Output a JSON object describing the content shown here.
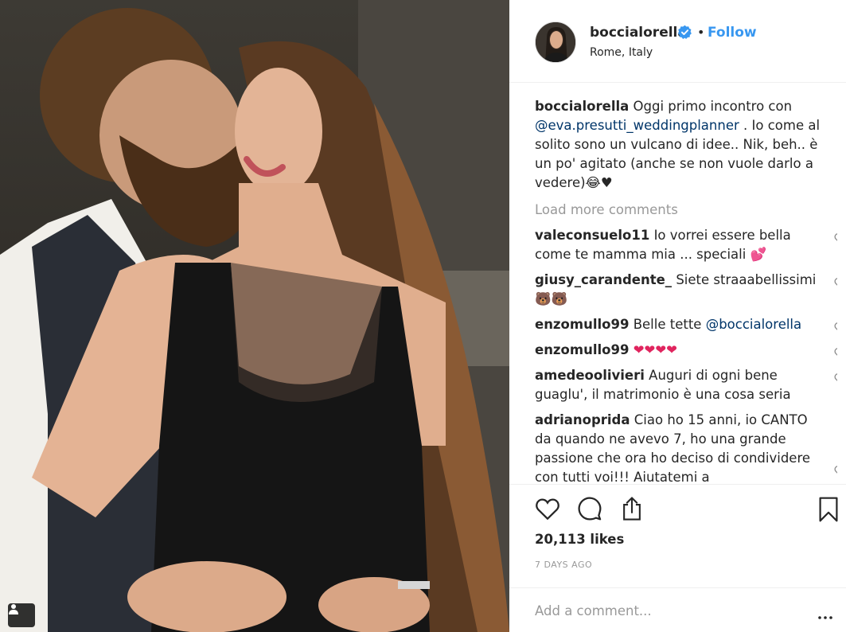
{
  "post": {
    "username": "boccialorella",
    "location": "Rome, Italy",
    "dot": "•",
    "follow_label": "Follow",
    "caption_text": "Oggi primo incontro con",
    "caption_mention": "@eva.presutti_weddingplanner",
    "caption_rest": ". Io come al solito sono un vulcano di idee.. Nik, beh.. è un po' agitato (anche se non vuole darlo a vedere)😂♥",
    "load_more": "Load more comments",
    "likes": "20,113 likes",
    "date": "7 DAYS AGO",
    "add_comment_placeholder": "Add a comment...",
    "more_options": "•••"
  },
  "comments": [
    {
      "user": "valeconsuelo11",
      "text": "Io vorrei essere bella come te mamma mia ... speciali 💕"
    },
    {
      "user": "giusy_carandente_",
      "text": "Siete straaabellissimi🐻🐻"
    },
    {
      "user": "enzomullo99",
      "text": "Belle tette",
      "mention": "@boccialorella"
    },
    {
      "user": "enzomullo99",
      "text": "❤❤❤❤"
    },
    {
      "user": "amedeoolivieri",
      "text": "Auguri di ogni bene guaglu', il matrimonio è una cosa seria"
    },
    {
      "user": "adrianoprida",
      "text": "Ciao ho 15 anni, io CANTO da quando ne avevo 7, ho una grande passione che ora ho deciso di condividere con tutti voi!!! Aiutatemi a"
    }
  ],
  "icons": {
    "verified": "verified-badge-icon",
    "like": "heart-icon",
    "comment": "comment-bubble-icon",
    "share": "share-icon",
    "save": "bookmark-icon",
    "tag": "user-tag-icon"
  },
  "colors": {
    "accent": "#3897f0",
    "mention": "#003569",
    "muted": "#999999",
    "text": "#262626",
    "heart_emoji": "#e0245e"
  }
}
